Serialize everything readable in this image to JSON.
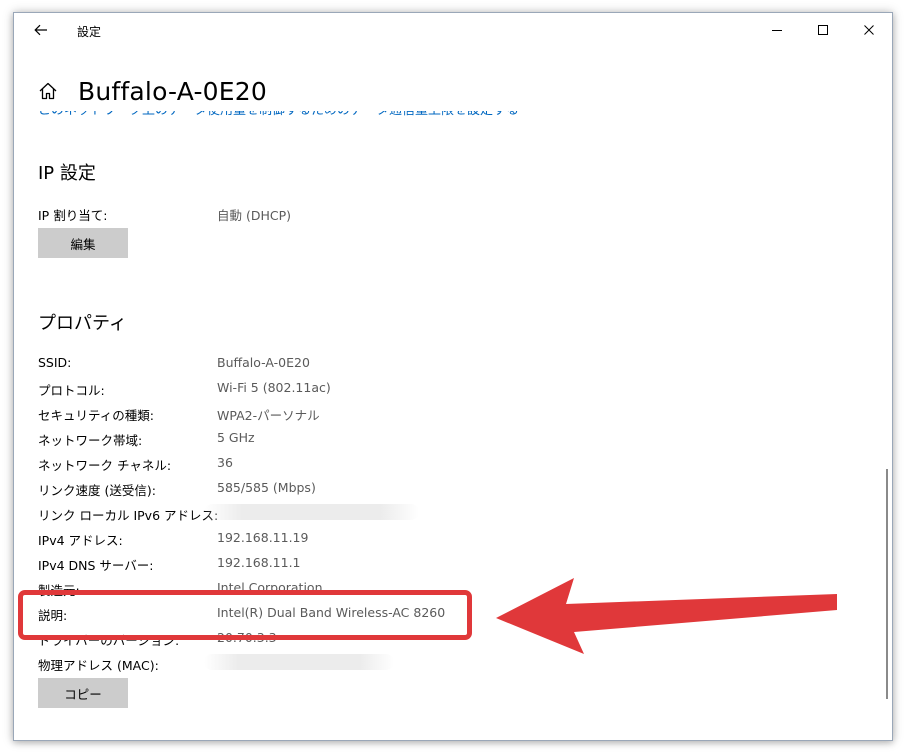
{
  "window": {
    "title": "設定",
    "icons": {
      "back": "back-arrow-icon",
      "minimize": "minimize-icon",
      "maximize": "maximize-icon",
      "close": "close-icon"
    }
  },
  "header": {
    "home_icon": "home-icon",
    "network_name": "Buffalo-A-0E20"
  },
  "link_cut": "このネットワーク上のデータ使用量を制御するためのデータ通信量上限を設定する",
  "ip_settings": {
    "title": "IP 設定",
    "assignment_label": "IP 割り当て:",
    "assignment_value": "自動 (DHCP)",
    "edit_button": "編集"
  },
  "properties": {
    "title": "プロパティ",
    "rows": [
      {
        "label": "SSID:",
        "value": "Buffalo-A-0E20"
      },
      {
        "label": "プロトコル:",
        "value": "Wi-Fi 5 (802.11ac)"
      },
      {
        "label": "セキュリティの種類:",
        "value": "WPA2-パーソナル"
      },
      {
        "label": "ネットワーク帯域:",
        "value": "5 GHz"
      },
      {
        "label": "ネットワーク チャネル:",
        "value": "36"
      },
      {
        "label": "リンク速度 (送受信):",
        "value": "585/585 (Mbps)"
      },
      {
        "label": "リンク ローカル IPv6 アドレス:",
        "value": ""
      },
      {
        "label": "IPv4 アドレス:",
        "value": "192.168.11.19"
      },
      {
        "label": "IPv4 DNS サーバー:",
        "value": "192.168.11.1"
      },
      {
        "label": "製造元:",
        "value": "Intel Corporation"
      },
      {
        "label": "説明:",
        "value": "Intel(R) Dual Band Wireless-AC 8260"
      },
      {
        "label": "ドライバーのバージョン:",
        "value": "20.70.3.3"
      },
      {
        "label": "物理アドレス (MAC):",
        "value": ""
      }
    ],
    "copy_button": "コピー"
  },
  "annotation": {
    "color": "#e0383a"
  }
}
